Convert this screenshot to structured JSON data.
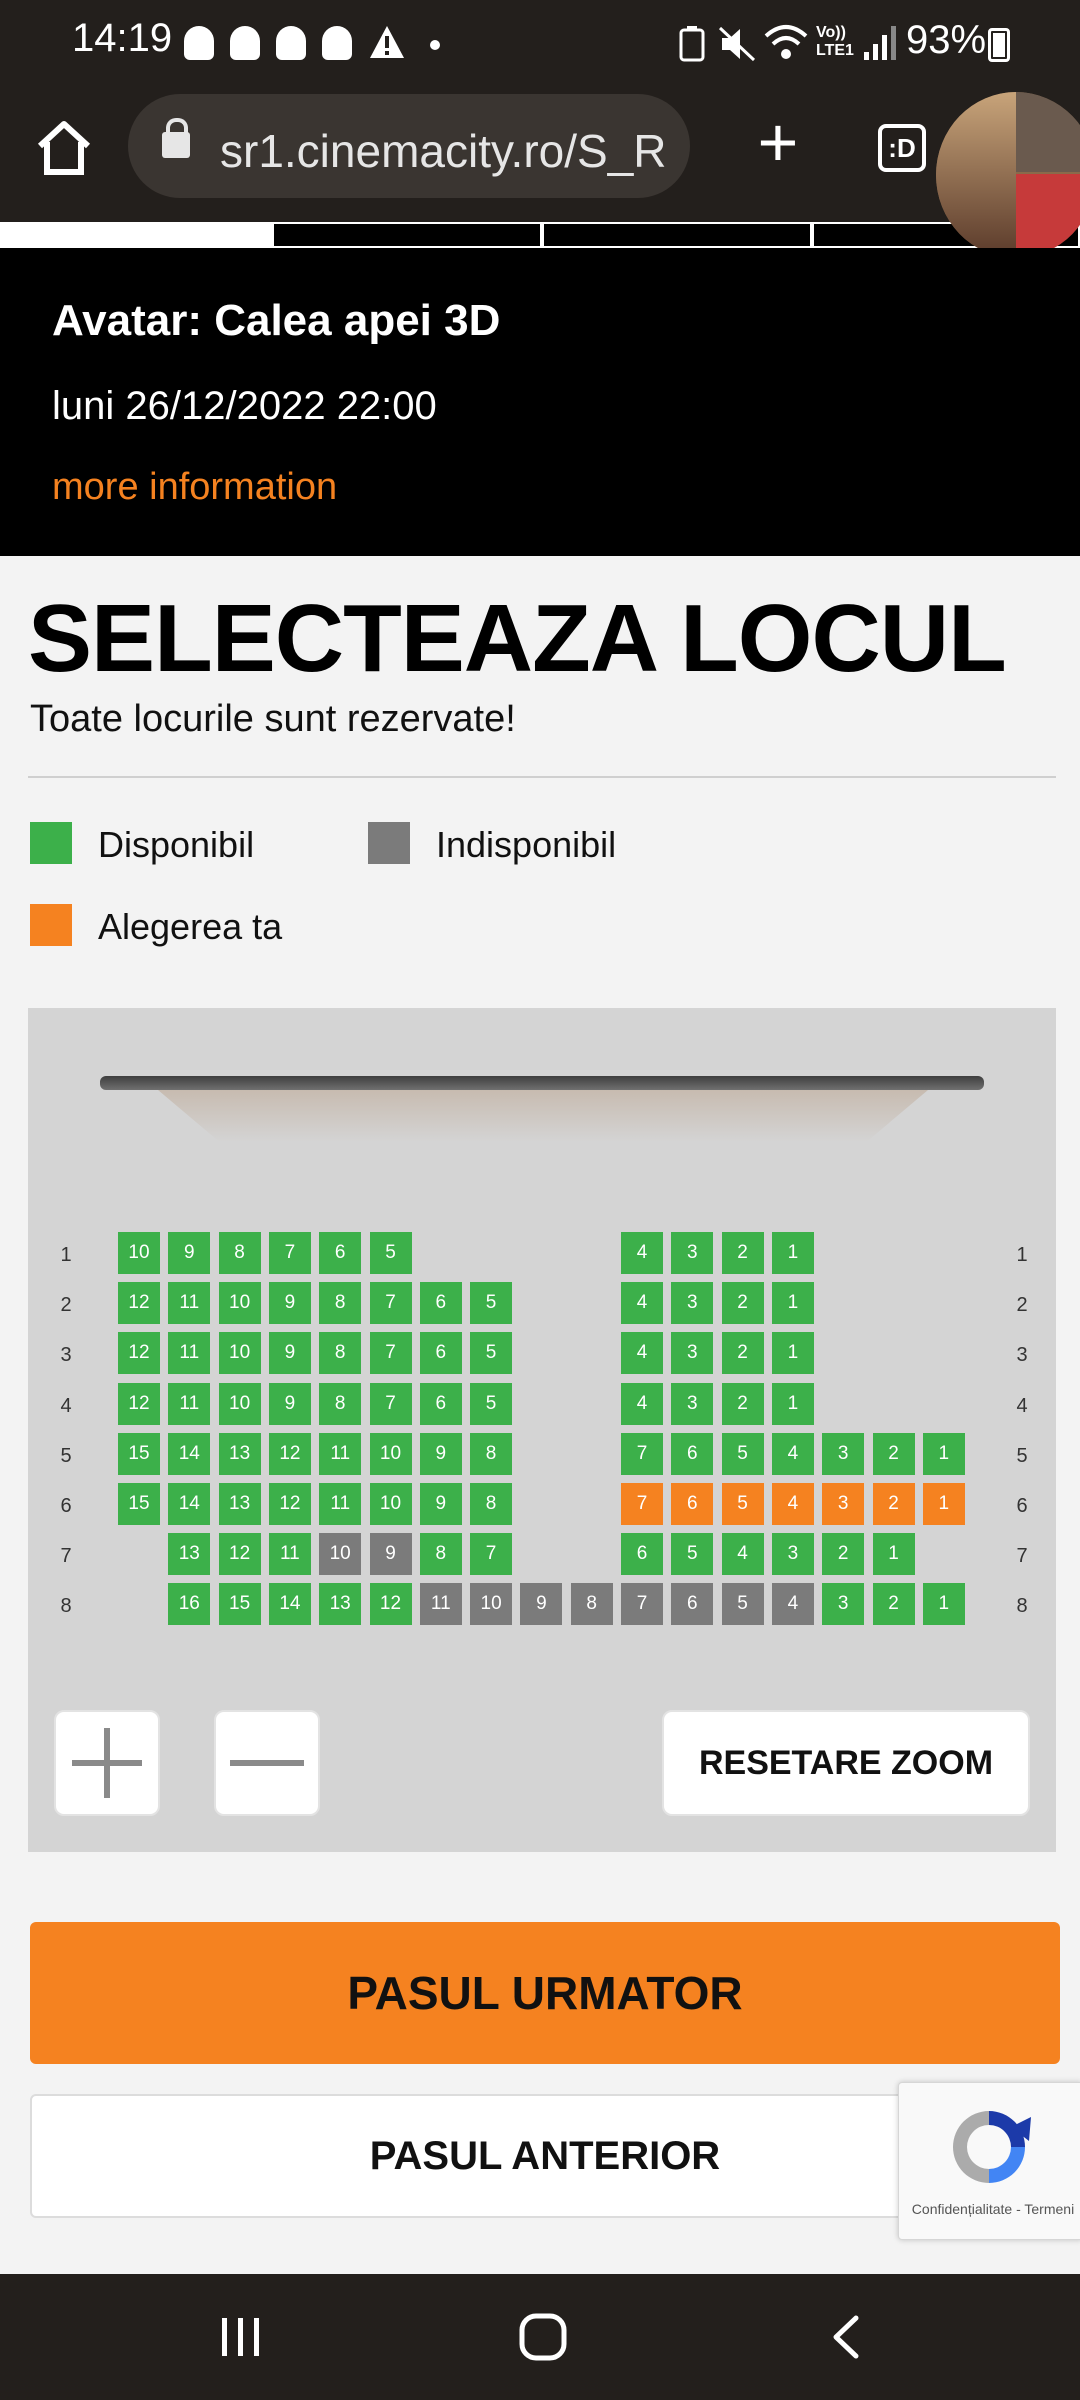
{
  "status_bar": {
    "time": "14:19",
    "battery": "93%"
  },
  "browser": {
    "url": "sr1.cinemacity.ro/S_R",
    "tabs_label": ":D"
  },
  "movie": {
    "title": "Avatar: Calea apei 3D",
    "datetime": "luni 26/12/2022 22:00",
    "more_info": "more information"
  },
  "selection": {
    "title": "SELECTEAZA LOCUL",
    "subtitle": "Toate locurile sunt rezervate!"
  },
  "legend": [
    {
      "label": "Disponibil",
      "color": "#3cb04a"
    },
    {
      "label": "Indisponibil",
      "color": "#7b7b7b"
    },
    {
      "label": "Alegerea ta",
      "color": "#f58220"
    }
  ],
  "seat_colors": {
    "available": "#3cb04a",
    "unavailable": "#7b7b7b",
    "selected": "#f58220"
  },
  "seat_map": {
    "rows": [
      {
        "row": "1",
        "seats": [
          {
            "n": "10",
            "s": "available"
          },
          {
            "n": "9",
            "s": "available"
          },
          {
            "n": "8",
            "s": "available"
          },
          {
            "n": "7",
            "s": "available"
          },
          {
            "n": "6",
            "s": "available"
          },
          {
            "n": "5",
            "s": "available"
          },
          {
            "n": "4",
            "s": "available"
          },
          {
            "n": "3",
            "s": "available"
          },
          {
            "n": "2",
            "s": "available"
          },
          {
            "n": "1",
            "s": "available"
          }
        ]
      },
      {
        "row": "2",
        "seats": [
          {
            "n": "12",
            "s": "available"
          },
          {
            "n": "11",
            "s": "available"
          },
          {
            "n": "10",
            "s": "available"
          },
          {
            "n": "9",
            "s": "available"
          },
          {
            "n": "8",
            "s": "available"
          },
          {
            "n": "7",
            "s": "available"
          },
          {
            "n": "6",
            "s": "available"
          },
          {
            "n": "5",
            "s": "available"
          },
          {
            "n": "4",
            "s": "available"
          },
          {
            "n": "3",
            "s": "available"
          },
          {
            "n": "2",
            "s": "available"
          },
          {
            "n": "1",
            "s": "available"
          }
        ]
      },
      {
        "row": "3",
        "seats": [
          {
            "n": "12",
            "s": "available"
          },
          {
            "n": "11",
            "s": "available"
          },
          {
            "n": "10",
            "s": "available"
          },
          {
            "n": "9",
            "s": "available"
          },
          {
            "n": "8",
            "s": "available"
          },
          {
            "n": "7",
            "s": "available"
          },
          {
            "n": "6",
            "s": "available"
          },
          {
            "n": "5",
            "s": "available"
          },
          {
            "n": "4",
            "s": "available"
          },
          {
            "n": "3",
            "s": "available"
          },
          {
            "n": "2",
            "s": "available"
          },
          {
            "n": "1",
            "s": "available"
          }
        ]
      },
      {
        "row": "4",
        "seats": [
          {
            "n": "12",
            "s": "available"
          },
          {
            "n": "11",
            "s": "available"
          },
          {
            "n": "10",
            "s": "available"
          },
          {
            "n": "9",
            "s": "available"
          },
          {
            "n": "8",
            "s": "available"
          },
          {
            "n": "7",
            "s": "available"
          },
          {
            "n": "6",
            "s": "available"
          },
          {
            "n": "5",
            "s": "available"
          },
          {
            "n": "4",
            "s": "available"
          },
          {
            "n": "3",
            "s": "available"
          },
          {
            "n": "2",
            "s": "available"
          },
          {
            "n": "1",
            "s": "available"
          }
        ]
      },
      {
        "row": "5",
        "seats": [
          {
            "n": "15",
            "s": "available"
          },
          {
            "n": "14",
            "s": "available"
          },
          {
            "n": "13",
            "s": "available"
          },
          {
            "n": "12",
            "s": "available"
          },
          {
            "n": "11",
            "s": "available"
          },
          {
            "n": "10",
            "s": "available"
          },
          {
            "n": "9",
            "s": "available"
          },
          {
            "n": "8",
            "s": "available"
          },
          {
            "n": "7",
            "s": "available"
          },
          {
            "n": "6",
            "s": "available"
          },
          {
            "n": "5",
            "s": "available"
          },
          {
            "n": "4",
            "s": "available"
          },
          {
            "n": "3",
            "s": "available"
          },
          {
            "n": "2",
            "s": "available"
          },
          {
            "n": "1",
            "s": "available"
          }
        ]
      },
      {
        "row": "6",
        "seats": [
          {
            "n": "15",
            "s": "available"
          },
          {
            "n": "14",
            "s": "available"
          },
          {
            "n": "13",
            "s": "available"
          },
          {
            "n": "12",
            "s": "available"
          },
          {
            "n": "11",
            "s": "available"
          },
          {
            "n": "10",
            "s": "available"
          },
          {
            "n": "9",
            "s": "available"
          },
          {
            "n": "8",
            "s": "available"
          },
          {
            "n": "7",
            "s": "selected"
          },
          {
            "n": "6",
            "s": "selected"
          },
          {
            "n": "5",
            "s": "selected"
          },
          {
            "n": "4",
            "s": "selected"
          },
          {
            "n": "3",
            "s": "selected"
          },
          {
            "n": "2",
            "s": "selected"
          },
          {
            "n": "1",
            "s": "selected"
          }
        ]
      },
      {
        "row": "7",
        "seats": [
          {
            "n": "13",
            "s": "available"
          },
          {
            "n": "12",
            "s": "available"
          },
          {
            "n": "11",
            "s": "available"
          },
          {
            "n": "10",
            "s": "unavailable"
          },
          {
            "n": "9",
            "s": "unavailable"
          },
          {
            "n": "8",
            "s": "available"
          },
          {
            "n": "7",
            "s": "available"
          },
          {
            "n": "6",
            "s": "available"
          },
          {
            "n": "5",
            "s": "available"
          },
          {
            "n": "4",
            "s": "available"
          },
          {
            "n": "3",
            "s": "available"
          },
          {
            "n": "2",
            "s": "available"
          },
          {
            "n": "1",
            "s": "available"
          }
        ]
      },
      {
        "row": "8",
        "seats": [
          {
            "n": "16",
            "s": "available"
          },
          {
            "n": "15",
            "s": "available"
          },
          {
            "n": "14",
            "s": "available"
          },
          {
            "n": "13",
            "s": "available"
          },
          {
            "n": "12",
            "s": "available"
          },
          {
            "n": "11",
            "s": "unavailable"
          },
          {
            "n": "10",
            "s": "unavailable"
          },
          {
            "n": "9",
            "s": "unavailable"
          },
          {
            "n": "8",
            "s": "unavailable"
          },
          {
            "n": "7",
            "s": "unavailable"
          },
          {
            "n": "6",
            "s": "unavailable"
          },
          {
            "n": "5",
            "s": "unavailable"
          },
          {
            "n": "4",
            "s": "unavailable"
          },
          {
            "n": "3",
            "s": "available"
          },
          {
            "n": "2",
            "s": "available"
          },
          {
            "n": "1",
            "s": "available"
          }
        ]
      }
    ]
  },
  "zoom": {
    "reset_label": "RESETARE ZOOM"
  },
  "actions": {
    "next_label": "PASUL URMATOR",
    "prev_label": "PASUL ANTERIOR"
  },
  "recaptcha": {
    "footer": "Confidențialitate - Termeni"
  }
}
